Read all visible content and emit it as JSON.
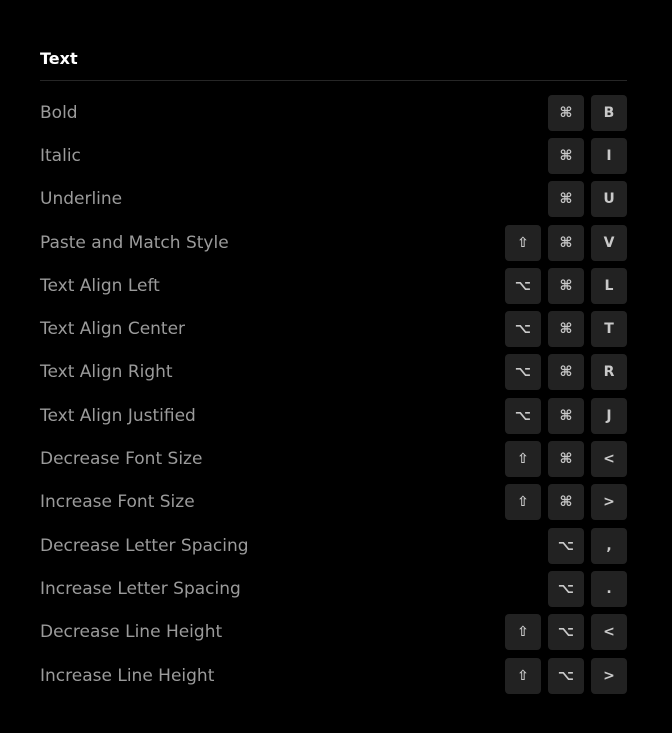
{
  "section": {
    "title": "Text"
  },
  "shortcuts": [
    {
      "label": "Bold",
      "keys": [
        "⌘",
        "B"
      ],
      "icons": [
        "command-icon",
        "key-b"
      ]
    },
    {
      "label": "Italic",
      "keys": [
        "⌘",
        "I"
      ],
      "icons": [
        "command-icon",
        "key-i"
      ]
    },
    {
      "label": "Underline",
      "keys": [
        "⌘",
        "U"
      ],
      "icons": [
        "command-icon",
        "key-u"
      ]
    },
    {
      "label": "Paste and Match Style",
      "keys": [
        "⇧",
        "⌘",
        "V"
      ],
      "icons": [
        "shift-icon",
        "command-icon",
        "key-v"
      ]
    },
    {
      "label": "Text Align Left",
      "keys": [
        "⌥",
        "⌘",
        "L"
      ],
      "icons": [
        "option-icon",
        "command-icon",
        "key-l"
      ]
    },
    {
      "label": "Text Align Center",
      "keys": [
        "⌥",
        "⌘",
        "T"
      ],
      "icons": [
        "option-icon",
        "command-icon",
        "key-t"
      ]
    },
    {
      "label": "Text Align Right",
      "keys": [
        "⌥",
        "⌘",
        "R"
      ],
      "icons": [
        "option-icon",
        "command-icon",
        "key-r"
      ]
    },
    {
      "label": "Text Align Justified",
      "keys": [
        "⌥",
        "⌘",
        "J"
      ],
      "icons": [
        "option-icon",
        "command-icon",
        "key-j"
      ]
    },
    {
      "label": "Decrease Font Size",
      "keys": [
        "⇧",
        "⌘",
        "<"
      ],
      "icons": [
        "shift-icon",
        "command-icon",
        "key-less-than"
      ]
    },
    {
      "label": "Increase Font Size",
      "keys": [
        "⇧",
        "⌘",
        ">"
      ],
      "icons": [
        "shift-icon",
        "command-icon",
        "key-greater-than"
      ]
    },
    {
      "label": "Decrease Letter Spacing",
      "keys": [
        "⌥",
        ","
      ],
      "icons": [
        "option-icon",
        "key-comma"
      ]
    },
    {
      "label": "Increase Letter Spacing",
      "keys": [
        "⌥",
        "."
      ],
      "icons": [
        "option-icon",
        "key-period"
      ]
    },
    {
      "label": "Decrease Line Height",
      "keys": [
        "⇧",
        "⌥",
        "<"
      ],
      "icons": [
        "shift-icon",
        "option-icon",
        "key-less-than"
      ]
    },
    {
      "label": "Increase Line Height",
      "keys": [
        "⇧",
        "⌥",
        ">"
      ],
      "icons": [
        "shift-icon",
        "option-icon",
        "key-greater-than"
      ]
    }
  ],
  "colors": {
    "background": "#000000",
    "title": "#ffffff",
    "label": "#9b9b9b",
    "key_background": "#222222",
    "key_text": "#c9c9c9",
    "divider": "#262626"
  }
}
